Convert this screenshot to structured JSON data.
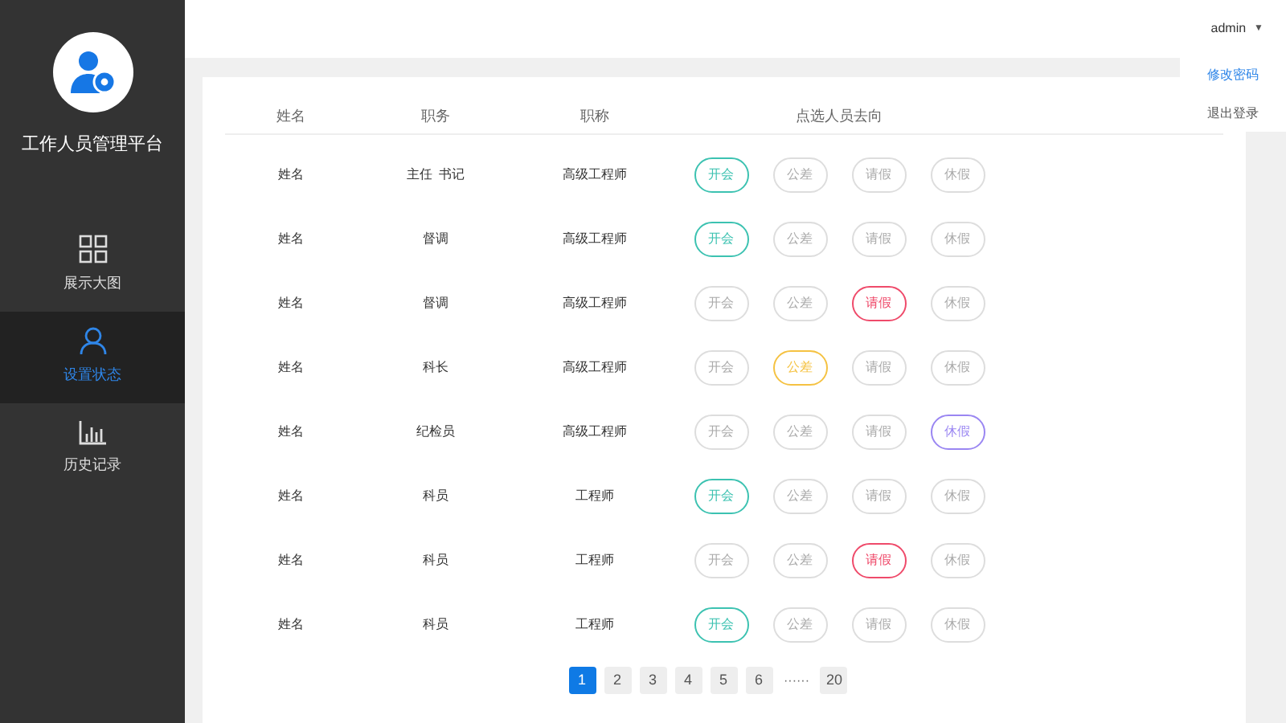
{
  "sidebar": {
    "title": "工作人员管理平台",
    "items": [
      {
        "label": "展示大图",
        "selected": false
      },
      {
        "label": "设置状态",
        "selected": true
      },
      {
        "label": "历史记录",
        "selected": false
      }
    ]
  },
  "user_menu": {
    "username": "admin",
    "caret": "▼",
    "items": [
      {
        "label": "修改密码",
        "selected": true
      },
      {
        "label": "退出登录",
        "selected": false
      }
    ]
  },
  "table": {
    "columns": [
      "姓名",
      "职务",
      "职称",
      "点选人员去向"
    ],
    "rows": [
      {
        "name": "姓名",
        "duty": "主任  书记",
        "title": "高级工程师",
        "options": [
          {
            "label": "开会",
            "selected": true
          },
          {
            "label": "公差",
            "selected": false
          },
          {
            "label": "请假",
            "selected": false
          },
          {
            "label": "休假",
            "selected": false
          }
        ]
      },
      {
        "name": "姓名",
        "duty": "督调",
        "title": "高级工程师",
        "options": [
          {
            "label": "开会",
            "selected": true
          },
          {
            "label": "公差",
            "selected": false
          },
          {
            "label": "请假",
            "selected": false
          },
          {
            "label": "休假",
            "selected": false
          }
        ]
      },
      {
        "name": "姓名",
        "duty": "督调",
        "title": "高级工程师",
        "options": [
          {
            "label": "开会",
            "selected": false
          },
          {
            "label": "公差",
            "selected": false
          },
          {
            "label": "请假",
            "selected": true
          },
          {
            "label": "休假",
            "selected": false
          }
        ]
      },
      {
        "name": "姓名",
        "duty": "科长",
        "title": "高级工程师",
        "options": [
          {
            "label": "开会",
            "selected": false
          },
          {
            "label": "公差",
            "selected": true
          },
          {
            "label": "请假",
            "selected": false
          },
          {
            "label": "休假",
            "selected": false
          }
        ]
      },
      {
        "name": "姓名",
        "duty": "纪检员",
        "title": "高级工程师",
        "options": [
          {
            "label": "开会",
            "selected": false
          },
          {
            "label": "公差",
            "selected": false
          },
          {
            "label": "请假",
            "selected": false
          },
          {
            "label": "休假",
            "selected": true
          }
        ]
      },
      {
        "name": "姓名",
        "duty": "科员",
        "title": "工程师",
        "options": [
          {
            "label": "开会",
            "selected": true
          },
          {
            "label": "公差",
            "selected": false
          },
          {
            "label": "请假",
            "selected": false
          },
          {
            "label": "休假",
            "selected": false
          }
        ]
      },
      {
        "name": "姓名",
        "duty": "科员",
        "title": "工程师",
        "options": [
          {
            "label": "开会",
            "selected": false
          },
          {
            "label": "公差",
            "selected": false
          },
          {
            "label": "请假",
            "selected": true
          },
          {
            "label": "休假",
            "selected": false
          }
        ]
      },
      {
        "name": "姓名",
        "duty": "科员",
        "title": "工程师",
        "options": [
          {
            "label": "开会",
            "selected": true
          },
          {
            "label": "公差",
            "selected": false
          },
          {
            "label": "请假",
            "selected": false
          },
          {
            "label": "休假",
            "selected": false
          }
        ]
      }
    ]
  },
  "pagination": [
    {
      "label": "1",
      "kind": "page",
      "selected": true
    },
    {
      "label": "2",
      "kind": "page",
      "selected": false
    },
    {
      "label": "3",
      "kind": "page",
      "selected": false
    },
    {
      "label": "4",
      "kind": "page",
      "selected": false
    },
    {
      "label": "5",
      "kind": "page",
      "selected": false
    },
    {
      "label": "6",
      "kind": "page",
      "selected": false
    },
    {
      "label": "······",
      "kind": "ellipsis"
    },
    {
      "label": "20",
      "kind": "page",
      "selected": false
    }
  ]
}
